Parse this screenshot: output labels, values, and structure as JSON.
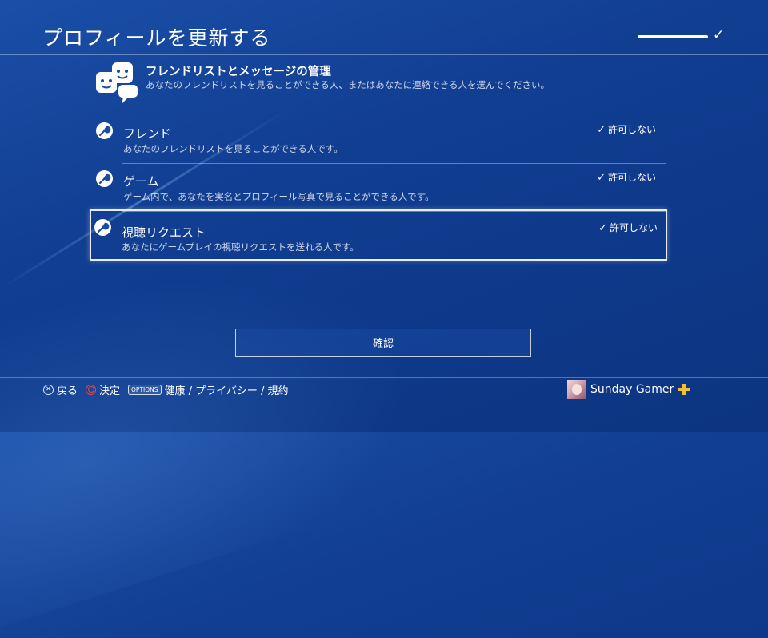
{
  "header": {
    "title": "プロフィールを更新する",
    "progress_check": "✓"
  },
  "section": {
    "title": "フレンドリストとメッセージの管理",
    "description": "あなたのフレンドリストを見ることができる人、またはあなたに連絡できる人を選んでください。"
  },
  "rows": [
    {
      "title": "フレンド",
      "description": "あなたのフレンドリストを見ることができる人です。",
      "value": "許可しない"
    },
    {
      "title": "ゲーム",
      "description": "ゲーム内で、あなたを実名とプロフィール写真で見ることができる人です。",
      "value": "許可しない"
    },
    {
      "title": "視聴リクエスト",
      "description": "あなたにゲームプレイの視聴リクエストを送れる人です。",
      "value": "許可しない"
    }
  ],
  "confirm_button": "確認",
  "footer": {
    "back": "戻る",
    "enter": "決定",
    "options_badge": "OPTIONS",
    "options_label": "健康 / プライバシー / 規約"
  },
  "user": {
    "name": "Sunday Gamer"
  },
  "colors": {
    "background": "#123f93",
    "plus_gold": "#f2c230",
    "circle_button": "#e04b4b"
  }
}
